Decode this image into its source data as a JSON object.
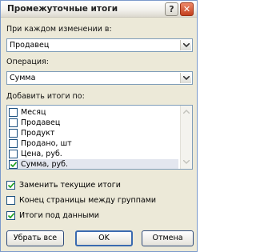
{
  "window": {
    "title": "Промежуточные итоги",
    "help_label": "?",
    "close_label": "✕"
  },
  "group_by": {
    "label": "При каждом изменении в:",
    "value": "Продавец"
  },
  "operation": {
    "label": "Операция:",
    "value": "Сумма"
  },
  "add_totals": {
    "label": "Добавить итоги по:",
    "items": [
      {
        "label": "Месяц",
        "checked": false
      },
      {
        "label": "Продавец",
        "checked": false
      },
      {
        "label": "Продукт",
        "checked": false
      },
      {
        "label": "Продано, шт",
        "checked": false
      },
      {
        "label": "Цена, руб.",
        "checked": false
      },
      {
        "label": "Сумма, руб.",
        "checked": true
      }
    ]
  },
  "options": [
    {
      "label": "Заменить текущие итоги",
      "checked": true
    },
    {
      "label": "Конец страницы между группами",
      "checked": false
    },
    {
      "label": "Итоги под данными",
      "checked": true
    }
  ],
  "buttons": {
    "remove_all": "Убрать все",
    "ok": "OK",
    "cancel": "Отмена"
  },
  "colors": {
    "dialog_bg": "#ece9d8",
    "field_border": "#7f9db9",
    "checkbox_border": "#1c5180",
    "check_mark": "#21a121",
    "close_red": "#c3401f"
  },
  "icons": {
    "help": "question-mark",
    "close": "x-mark",
    "dropdown": "chevron-down",
    "check": "check-mark"
  }
}
